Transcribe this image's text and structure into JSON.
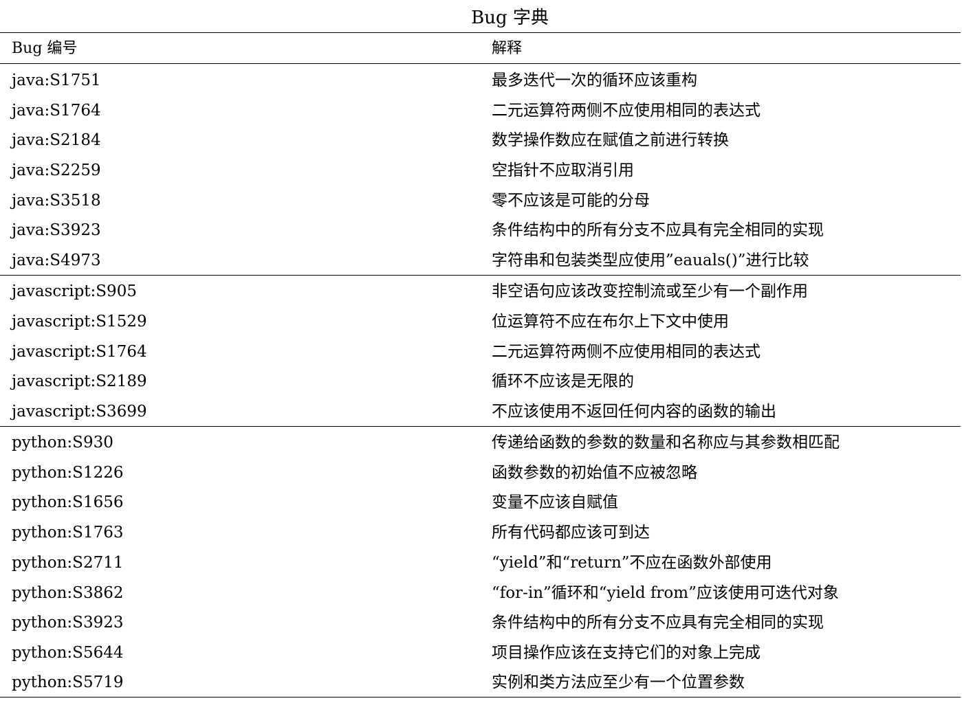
{
  "title": "Bug 字典",
  "header": {
    "id_label": "Bug 编号",
    "desc_label": "解释"
  },
  "groups": [
    {
      "rows": [
        {
          "id": "java:S1751",
          "desc": "最多迭代一次的循环应该重构"
        },
        {
          "id": "java:S1764",
          "desc": "二元运算符两侧不应使用相同的表达式"
        },
        {
          "id": "java:S2184",
          "desc": "数学操作数应在赋值之前进行转换"
        },
        {
          "id": "java:S2259",
          "desc": "空指针不应取消引用"
        },
        {
          "id": "java:S3518",
          "desc": "零不应该是可能的分母"
        },
        {
          "id": "java:S3923",
          "desc": "条件结构中的所有分支不应具有完全相同的实现"
        },
        {
          "id": "java:S4973",
          "desc": "字符串和包装类型应使用”eauals()”进行比较"
        }
      ]
    },
    {
      "rows": [
        {
          "id": "javascript:S905",
          "desc": "非空语句应该改变控制流或至少有一个副作用"
        },
        {
          "id": "javascript:S1529",
          "desc": "位运算符不应在布尔上下文中使用"
        },
        {
          "id": "javascript:S1764",
          "desc": "二元运算符两侧不应使用相同的表达式"
        },
        {
          "id": "javascript:S2189",
          "desc": "循环不应该是无限的"
        },
        {
          "id": "javascript:S3699",
          "desc": "不应该使用不返回任何内容的函数的输出"
        }
      ]
    },
    {
      "rows": [
        {
          "id": "python:S930",
          "desc": "传递给函数的参数的数量和名称应与其参数相匹配"
        },
        {
          "id": "python:S1226",
          "desc": "函数参数的初始值不应被忽略"
        },
        {
          "id": "python:S1656",
          "desc": "变量不应该自赋值"
        },
        {
          "id": "python:S1763",
          "desc": "所有代码都应该可到达"
        },
        {
          "id": "python:S2711",
          "desc": "“yield”和“return”不应在函数外部使用"
        },
        {
          "id": "python:S3862",
          "desc": "“for-in”循环和“yield from”应该使用可迭代对象"
        },
        {
          "id": "python:S3923",
          "desc": "条件结构中的所有分支不应具有完全相同的实现"
        },
        {
          "id": "python:S5644",
          "desc": "项目操作应该在支持它们的对象上完成"
        },
        {
          "id": "python:S5719",
          "desc": "实例和类方法应至少有一个位置参数"
        }
      ]
    }
  ]
}
